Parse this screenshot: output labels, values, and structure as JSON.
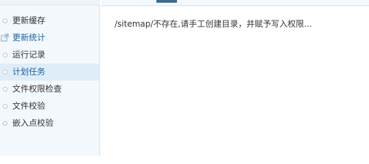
{
  "sidebar": {
    "items": [
      {
        "label": "更新缓存"
      },
      {
        "label": "更新统计"
      },
      {
        "label": "运行记录"
      },
      {
        "label": "计划任务"
      },
      {
        "label": "文件权限检查"
      },
      {
        "label": "文件校验"
      },
      {
        "label": "嵌入点校验"
      }
    ],
    "active_item": "计划任务",
    "highlight_color": "#deedf8"
  },
  "main": {
    "message": "/sitemap/不存在,请手工创建目录，并赋予写入权限..."
  }
}
